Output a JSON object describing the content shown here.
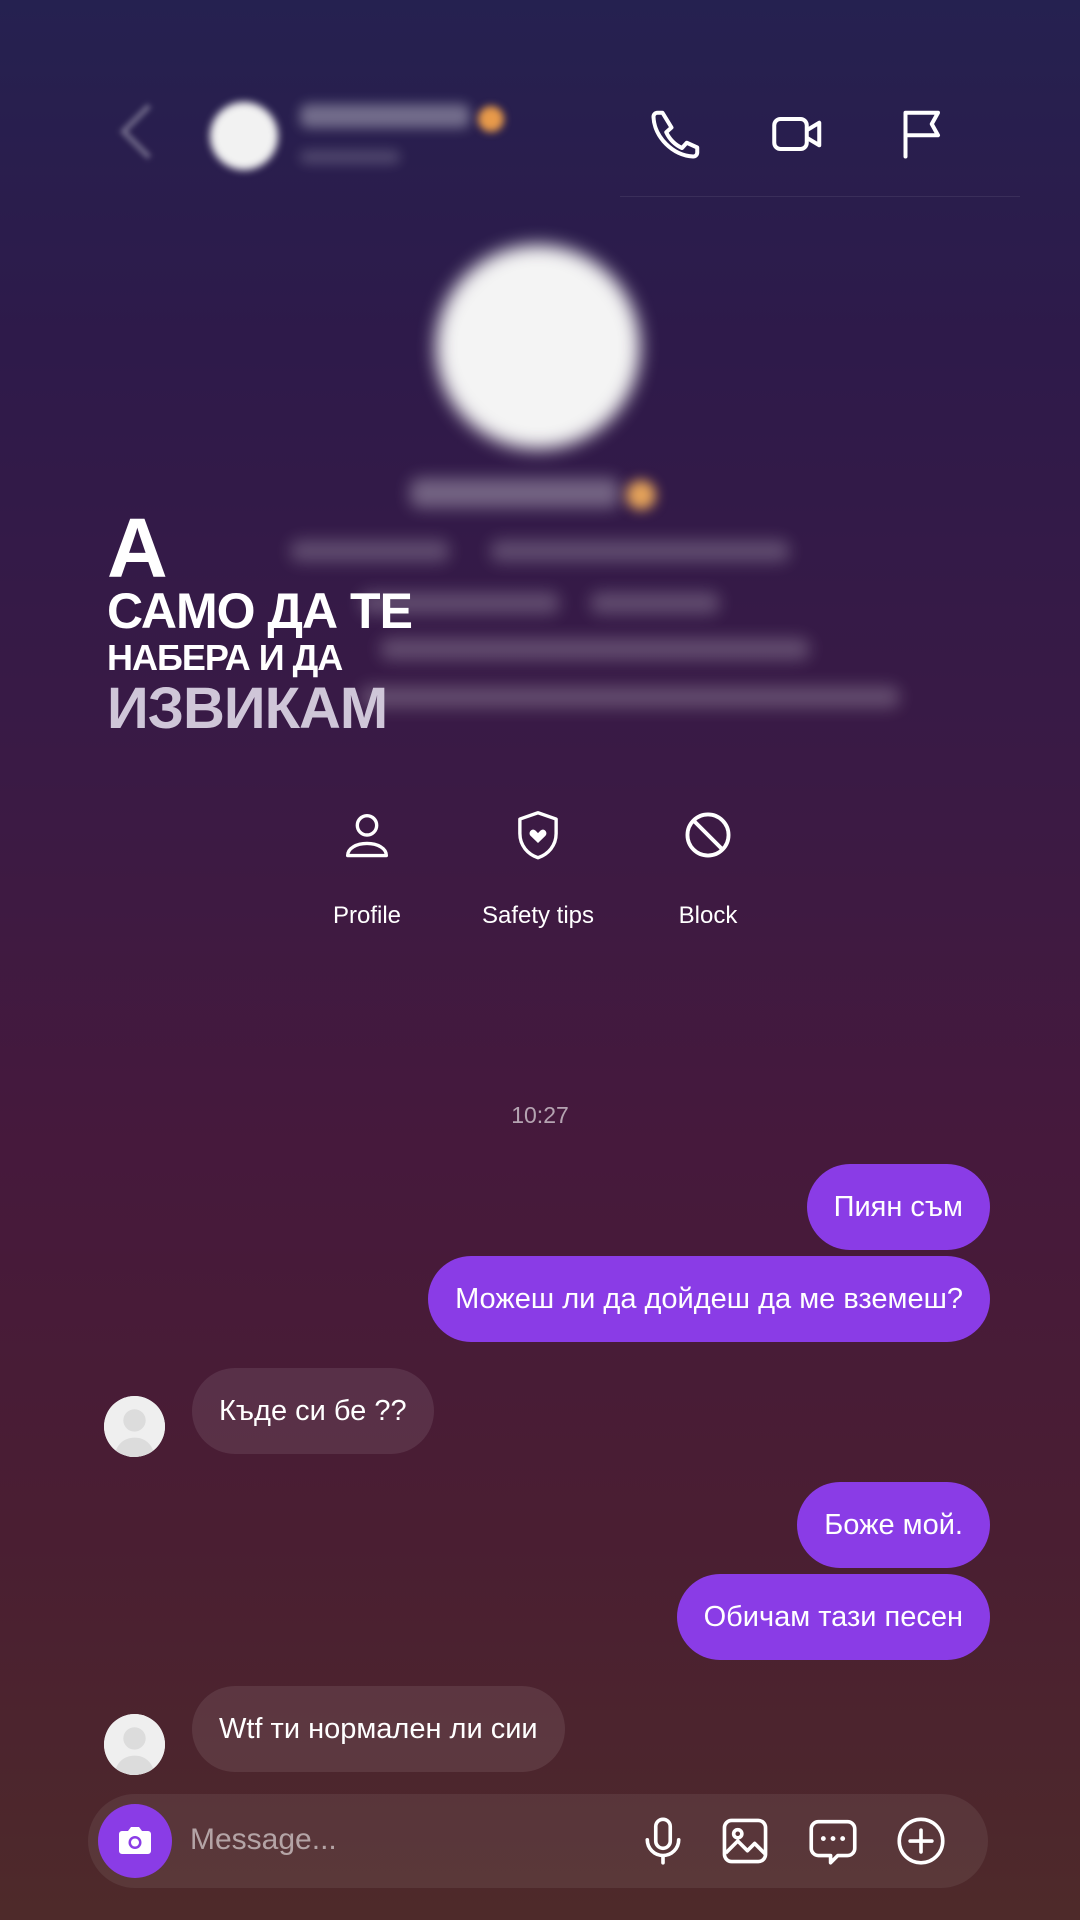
{
  "overlay_caption": {
    "line1": "А",
    "line2": "САМО ДА ТЕ",
    "line3": "НАБЕРА И ДА",
    "line4": "ИЗВИКАМ"
  },
  "header": {
    "icons": [
      "phone-icon",
      "video-camera-icon",
      "flag-icon"
    ]
  },
  "actions": [
    {
      "label": "Profile",
      "icon": "person-icon"
    },
    {
      "label": "Safety tips",
      "icon": "shield-heart-icon"
    },
    {
      "label": "Block",
      "icon": "block-icon"
    }
  ],
  "chat": {
    "timestamp": "10:27",
    "messages": [
      {
        "from": "me",
        "text": "Пиян съм"
      },
      {
        "from": "me",
        "text": "Можеш ли да дойдеш да ме вземеш?"
      },
      {
        "from": "them",
        "text": "Къде си бе ??"
      },
      {
        "from": "me",
        "text": "Боже мой."
      },
      {
        "from": "me",
        "text": "Обичам тази песен"
      },
      {
        "from": "them",
        "text": "Wtf ти нормален ли сии"
      }
    ]
  },
  "composer": {
    "placeholder": "Message...",
    "icons": [
      "camera-icon",
      "microphone-icon",
      "image-icon",
      "chat-bubble-icon",
      "plus-circle-icon"
    ]
  },
  "colors": {
    "accent": "#8a3ce6",
    "incoming_bubble": "rgba(255,255,255,0.09)",
    "text": "#ffffff"
  }
}
